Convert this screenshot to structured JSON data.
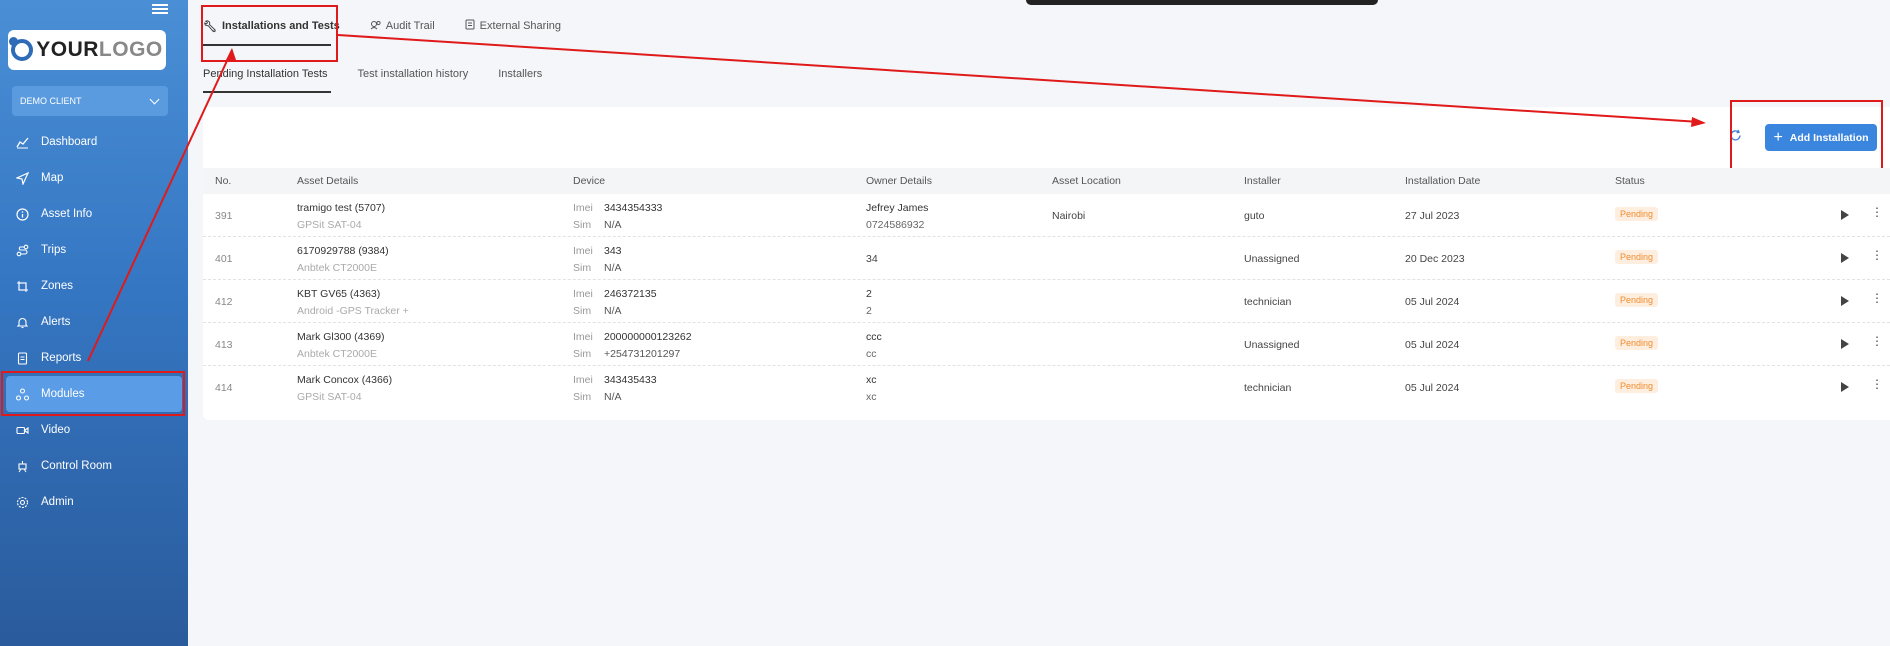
{
  "sidebar": {
    "logo": {
      "text_main": "YOUR",
      "text_accent": "LOGO"
    },
    "client": {
      "selected": "DEMO CLIENT"
    },
    "items": [
      {
        "label": "Dashboard",
        "icon": "chart-line-icon"
      },
      {
        "label": "Map",
        "icon": "navigation-arrow-icon"
      },
      {
        "label": "Asset Info",
        "icon": "info-circle-icon"
      },
      {
        "label": "Trips",
        "icon": "route-icon"
      },
      {
        "label": "Zones",
        "icon": "zone-icon"
      },
      {
        "label": "Alerts",
        "icon": "bell-icon"
      },
      {
        "label": "Reports",
        "icon": "document-icon"
      },
      {
        "label": "Modules",
        "icon": "modules-icon",
        "active": true
      },
      {
        "label": "Video",
        "icon": "video-icon"
      },
      {
        "label": "Control Room",
        "icon": "control-room-icon"
      },
      {
        "label": "Admin",
        "icon": "gear-icon"
      }
    ]
  },
  "tabs": [
    {
      "label": "Installations and Tests",
      "icon": "wrench-icon",
      "active": true
    },
    {
      "label": "Audit Trail",
      "icon": "audit-icon"
    },
    {
      "label": "External Sharing",
      "icon": "share-doc-icon"
    }
  ],
  "subtabs": [
    {
      "label": "Pending Installation Tests",
      "active": true
    },
    {
      "label": "Test installation history"
    },
    {
      "label": "Installers"
    }
  ],
  "actions": {
    "add_label": "Add Installation"
  },
  "table": {
    "headers": [
      "No.",
      "Asset Details",
      "Device",
      "Owner Details",
      "Asset Location",
      "Installer",
      "Installation Date",
      "Status"
    ],
    "device_labels": {
      "imei": "Imei",
      "sim": "Sim"
    },
    "rows": [
      {
        "no": "391",
        "asset": "tramigo test (5707)",
        "model": "GPSit SAT-04",
        "imei": "3434354333",
        "sim": "N/A",
        "owner": "Jefrey James",
        "owner_phone": "0724586932",
        "location": "Nairobi",
        "installer": "guto",
        "date": "27 Jul 2023",
        "status": "Pending"
      },
      {
        "no": "401",
        "asset": "6170929788 (9384)",
        "model": "Anbtek CT2000E",
        "imei": "343",
        "sim": "N/A",
        "owner": "34",
        "owner_phone": "",
        "location": "",
        "installer": "Unassigned",
        "date": "20 Dec 2023",
        "status": "Pending"
      },
      {
        "no": "412",
        "asset": "KBT GV65 (4363)",
        "model": "Android -GPS Tracker +",
        "imei": "246372135",
        "sim": "N/A",
        "owner": "2",
        "owner_phone": "2",
        "location": "",
        "installer": "technician",
        "date": "05 Jul 2024",
        "status": "Pending"
      },
      {
        "no": "413",
        "asset": "Mark Gl300 (4369)",
        "model": "Anbtek CT2000E",
        "imei": "200000000123262",
        "sim": "+254731201297",
        "owner": "ccc",
        "owner_phone": "cc",
        "location": "",
        "installer": "Unassigned",
        "date": "05 Jul 2024",
        "status": "Pending"
      },
      {
        "no": "414",
        "asset": "Mark Concox (4366)",
        "model": "GPSit SAT-04",
        "imei": "343435433",
        "sim": "N/A",
        "owner": "xc",
        "owner_phone": "xc",
        "location": "",
        "installer": "technician",
        "date": "05 Jul 2024",
        "status": "Pending"
      }
    ]
  },
  "colors": {
    "sidebar": "#3576c2",
    "accent": "#3a85de",
    "annotation": "#e01a1a",
    "pending": "#f08c2e"
  }
}
